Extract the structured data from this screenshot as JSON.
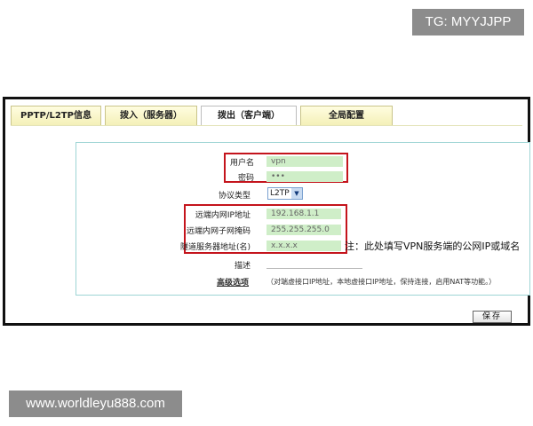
{
  "watermarks": {
    "top": "TG: MYYJJPP",
    "bottom": "www.worldleyu888.com"
  },
  "tabs": [
    {
      "label": "PPTP/L2TP信息",
      "active": false
    },
    {
      "label": "拨入（服务器）",
      "active": false
    },
    {
      "label": "拨出（客户端）",
      "active": true
    },
    {
      "label": "全局配置",
      "active": false
    }
  ],
  "form": {
    "username_label": "用户名",
    "username_value": "vpn",
    "password_label": "密码",
    "password_value": "•••",
    "protocol_label": "协议类型",
    "protocol_value": "L2TP",
    "remote_ip_label": "远端内网IP地址",
    "remote_ip_value": "192.168.1.1",
    "remote_mask_label": "远端内网子网掩码",
    "remote_mask_value": "255.255.255.0",
    "tunnel_server_label": "隧道服务器地址(名)",
    "tunnel_server_value": "x.x.x.x",
    "description_label": "描述",
    "advanced_label": "高级选项",
    "advanced_note": "（对端虚接口IP地址，本地虚接口IP地址，保持连接，启用NAT等功能。）"
  },
  "annotation": "注：此处填写VPN服务端的公网IP或域名",
  "save_label": "保存",
  "colors": {
    "highlight_box": "#c4141c",
    "input_bg": "#cfeec8",
    "panel_border": "#9ed4d4"
  }
}
